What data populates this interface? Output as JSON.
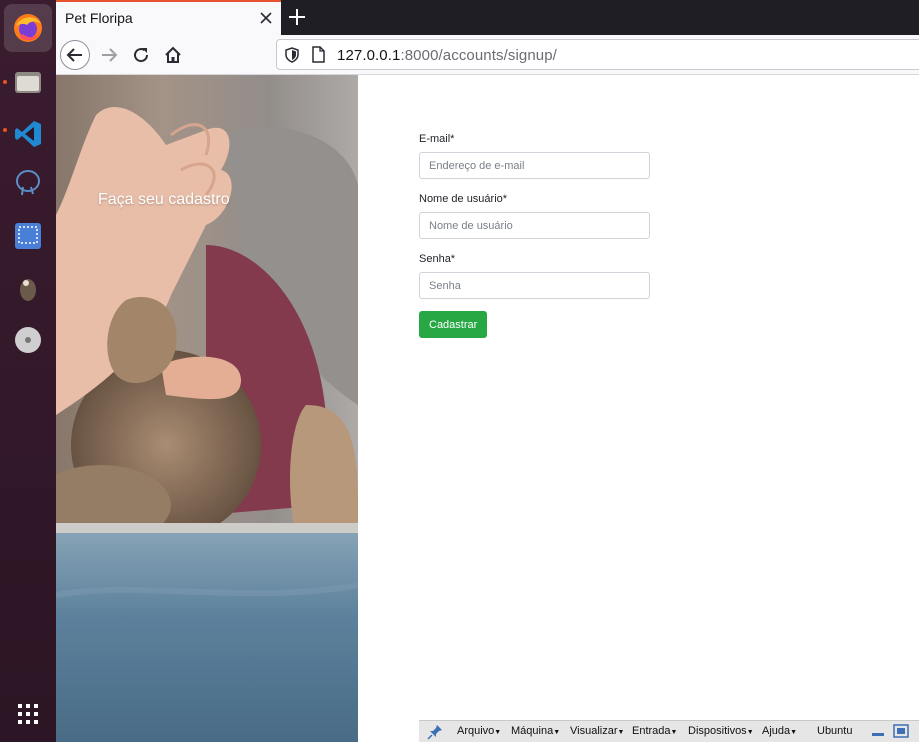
{
  "browser": {
    "tab_title": "Pet Floripa",
    "url_host": "127.0.0.1",
    "url_rest": ":8000/accounts/signup/"
  },
  "dock": {
    "items": [
      "firefox-icon",
      "files-icon",
      "vscode-icon",
      "postgresql-icon",
      "screenshot-icon",
      "gimp-icon",
      "dvd-icon",
      "apps-grid-icon"
    ]
  },
  "hero": {
    "title": "Faça seu cadastro"
  },
  "form": {
    "email_label": "E-mail*",
    "email_placeholder": "Endereço de e-mail",
    "username_label": "Nome de usuário*",
    "username_placeholder": "Nome de usuário",
    "password_label": "Senha*",
    "password_placeholder": "Senha",
    "submit_label": "Cadastrar"
  },
  "vbox_menu": {
    "arquivo": "Arquivo",
    "maquina": "Máquina",
    "visualizar": "Visualizar",
    "entrada": "Entrada",
    "dispositivos": "Dispositivos",
    "ajuda": "Ajuda",
    "ubuntu": "Ubuntu"
  },
  "colors": {
    "submit": "#28a745",
    "dock": "#2c1524",
    "tab_accent": "#e5522d"
  }
}
